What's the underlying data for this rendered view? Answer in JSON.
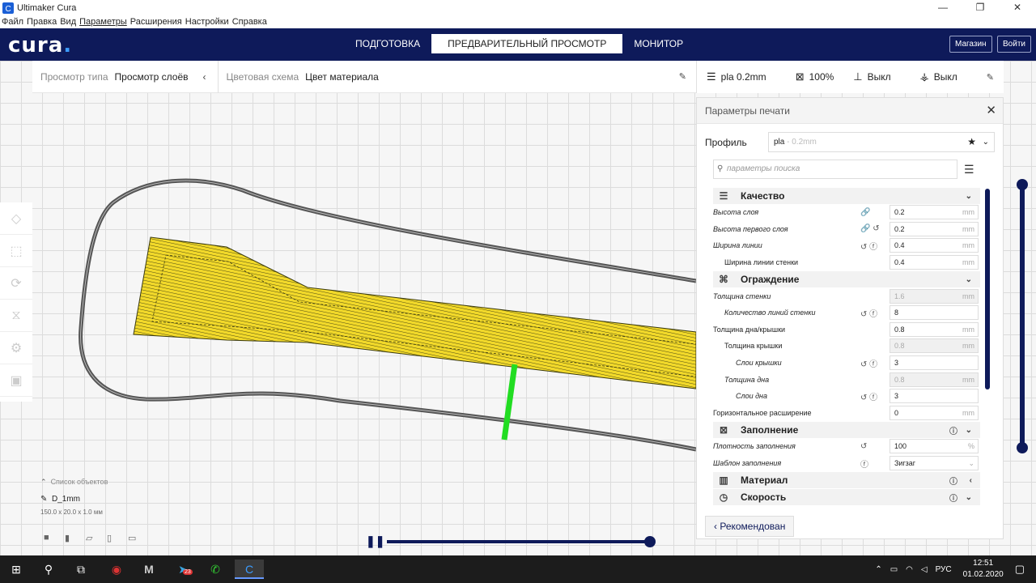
{
  "window": {
    "title": "Ultimaker Cura",
    "minimize": "—",
    "maximize": "❐",
    "close": "✕"
  },
  "menu": [
    "Файл",
    "Правка",
    "Вид",
    "Параметры",
    "Расширения",
    "Настройки",
    "Справка"
  ],
  "header": {
    "logo_text": "cura",
    "logo_dot": ".",
    "tabs": [
      "ПОДГОТОВКА",
      "ПРЕДВАРИТЕЛЬНЫЙ ПРОСМОТР",
      "МОНИТОР"
    ],
    "marketplace": "Магазин",
    "signin": "Войти"
  },
  "view_panel": {
    "view_type_label": "Просмотр типа",
    "view_type_value": "Просмотр слоёв",
    "color_scheme_label": "Цветовая схема",
    "color_scheme_value": "Цвет материала"
  },
  "summary": {
    "profile": "pla 0.2mm",
    "infill": "100%",
    "support": "Выкл",
    "adhesion": "Выкл"
  },
  "print_settings": {
    "title": "Параметры печати",
    "profile_label": "Профиль",
    "profile_value": "pla",
    "profile_faded": "- 0.2mm",
    "search_placeholder": "параметры поиска",
    "categories": [
      {
        "label": "Качество",
        "rows": [
          {
            "label": "Высота слоя",
            "value": "0.2",
            "unit": "mm",
            "icons": "🔗",
            "indent": 0,
            "italic": true
          },
          {
            "label": "Высота первого слоя",
            "value": "0.2",
            "unit": "mm",
            "icons": "🔗 ↺",
            "indent": 0,
            "italic": true
          },
          {
            "label": "Ширина линии",
            "value": "0.4",
            "unit": "mm",
            "icons": "↺ ⓕ",
            "indent": 0,
            "italic": true
          },
          {
            "label": "Ширина линии стенки",
            "value": "0.4",
            "unit": "mm",
            "icons": "",
            "indent": 1,
            "italic": false
          }
        ]
      },
      {
        "label": "Ограждение",
        "rows": [
          {
            "label": "Толщина стенки",
            "value": "1.6",
            "unit": "mm",
            "icons": "",
            "indent": 0,
            "italic": true,
            "disabled": true
          },
          {
            "label": "Количество линий стенки",
            "value": "8",
            "unit": "",
            "icons": "↺ ⓕ",
            "indent": 1,
            "italic": true
          },
          {
            "label": "Толщина дна/крышки",
            "value": "0.8",
            "unit": "mm",
            "icons": "",
            "indent": 0,
            "italic": false
          },
          {
            "label": "Толщина крышки",
            "value": "0.8",
            "unit": "mm",
            "icons": "",
            "indent": 1,
            "italic": false,
            "disabled": true
          },
          {
            "label": "Слои крышки",
            "value": "3",
            "unit": "",
            "icons": "↺ ⓕ",
            "indent": 2,
            "italic": true
          },
          {
            "label": "Толщина дна",
            "value": "0.8",
            "unit": "mm",
            "icons": "",
            "indent": 1,
            "italic": true,
            "disabled": true
          },
          {
            "label": "Слои дна",
            "value": "3",
            "unit": "",
            "icons": "↺ ⓕ",
            "indent": 2,
            "italic": true
          },
          {
            "label": "Горизонтальное расширение",
            "value": "0",
            "unit": "mm",
            "icons": "",
            "indent": 0,
            "italic": false
          }
        ]
      },
      {
        "label": "Заполнение",
        "info": true,
        "rows": [
          {
            "label": "Плотность заполнения",
            "value": "100",
            "unit": "%",
            "icons": "↺",
            "indent": 0,
            "italic": true
          },
          {
            "label": "Шаблон заполнения",
            "value": "Зигзаг",
            "unit": "⌄",
            "icons": "ⓕ",
            "indent": 0,
            "italic": true
          }
        ]
      },
      {
        "label": "Материал",
        "info": true,
        "collapsed": true,
        "rows": []
      },
      {
        "label": "Скорость",
        "info": true,
        "rows": []
      }
    ],
    "recommended_button": "Рекомендован"
  },
  "objects": {
    "list_label": "Список объектов",
    "name": "D_1mm",
    "size": "150.0 x 20.0 x 1.0 мм"
  },
  "taskbar": {
    "time": "12:51",
    "date": "01.02.2020",
    "lang": "РУС",
    "badge": "23"
  }
}
